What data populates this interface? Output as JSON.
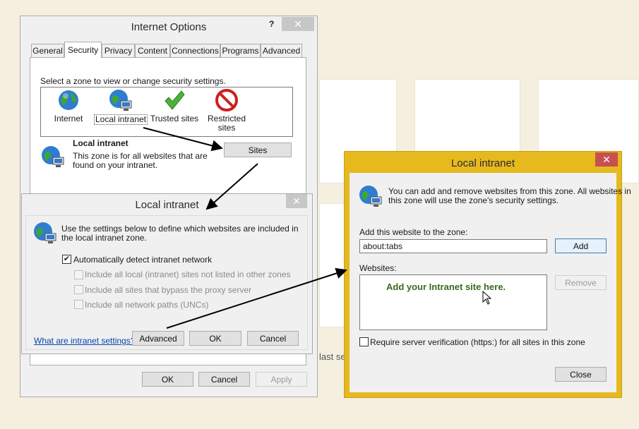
{
  "background": {
    "partial_text": "last se"
  },
  "internet_options": {
    "title": "Internet Options",
    "help_glyph": "?",
    "close_glyph": "✕",
    "tabs": [
      "General",
      "Security",
      "Privacy",
      "Content",
      "Connections",
      "Programs",
      "Advanced"
    ],
    "active_tab": "Security",
    "zone_prompt": "Select a zone to view or change security settings.",
    "zones": [
      {
        "label": "Internet",
        "icon": "globe-icon"
      },
      {
        "label": "Local intranet",
        "icon": "globe-computer-icon"
      },
      {
        "label": "Trusted sites",
        "icon": "checkmark-icon"
      },
      {
        "label_line1": "Restricted",
        "label_line2": "sites",
        "icon": "no-entry-icon"
      }
    ],
    "selected_zone": {
      "name": "Local intranet",
      "desc_line1": "This zone is for all websites that are",
      "desc_line2": "found on your intranet."
    },
    "sites_button": "Sites",
    "footer": {
      "ok": "OK",
      "cancel": "Cancel",
      "apply": "Apply"
    }
  },
  "local_intranet_settings": {
    "title": "Local intranet",
    "close_glyph": "✕",
    "intro_line1": "Use the settings below to define which websites are included in",
    "intro_line2": "the local intranet zone.",
    "checkboxes": [
      {
        "label": "Automatically detect intranet network",
        "checked": true,
        "enabled": true
      },
      {
        "label": "Include all local (intranet) sites not listed in other zones",
        "checked": false,
        "enabled": false
      },
      {
        "label": "Include all sites that bypass the proxy server",
        "checked": false,
        "enabled": false
      },
      {
        "label": "Include all network paths (UNCs)",
        "checked": false,
        "enabled": false
      }
    ],
    "check_mark": "✔",
    "help_link": "What are intranet settings?",
    "advanced_button": "Advanced",
    "ok_button": "OK",
    "cancel_button": "Cancel"
  },
  "local_intranet_sites": {
    "title": "Local intranet",
    "close_glyph": "✕",
    "info_line1": "You can add and remove websites from this zone. All websites in",
    "info_line2": "this zone will use the zone's security settings.",
    "add_label": "Add this website to the zone:",
    "add_value": "about:tabs",
    "add_button": "Add",
    "websites_label": "Websites:",
    "websites_annotation": "Add your Intranet site here.",
    "remove_button": "Remove",
    "require_https_label": "Require server verification (https:) for all sites in this zone",
    "require_https_checked": false,
    "close_button": "Close"
  },
  "colors": {
    "accent_frame": "#e6b91e",
    "annotation_green": "#3a6b1e",
    "close_red": "#c75050"
  }
}
